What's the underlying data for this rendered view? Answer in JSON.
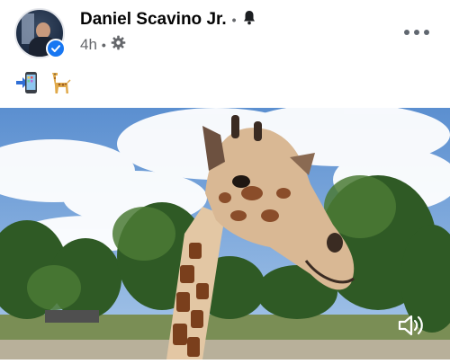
{
  "post": {
    "author": "Daniel Scavino Jr.",
    "separator": "•",
    "time": "4h",
    "meta_separator": "•"
  },
  "icons": {
    "avatar": "avatar-photo",
    "verified": "verified-badge-icon",
    "notify": "bell-icon",
    "privacy": "gear-icon",
    "more": "more-options-icon",
    "emoji_1": "mobile-phone-with-arrow-emoji",
    "emoji_2": "giraffe-emoji",
    "audio": "speaker-icon"
  },
  "colors": {
    "verified": "#1877f2",
    "meta_text": "#65676b",
    "name_text": "#050505"
  }
}
